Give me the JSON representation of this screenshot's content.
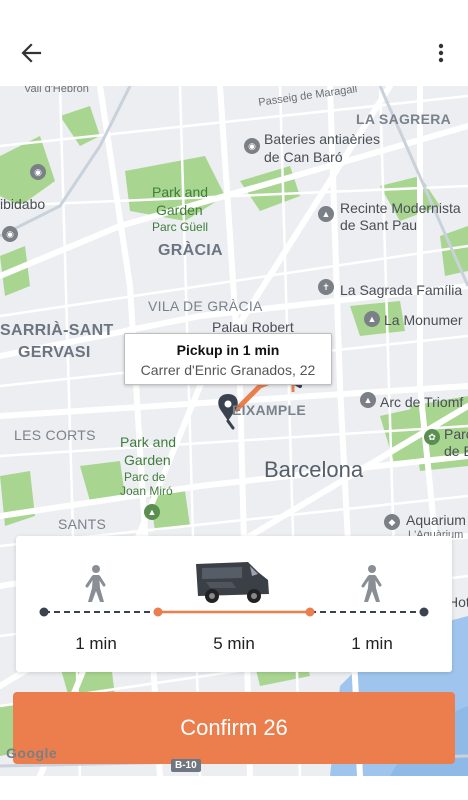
{
  "header": {
    "back_icon": "arrow-left-icon",
    "more_icon": "more-vertical-icon"
  },
  "map": {
    "labels": {
      "vall_hebron": "Vall d'Hebron",
      "passeig_maragall": "Passeig de Maragall",
      "la_sagrera": "LA SAGRERA",
      "bateries_1": "Bateries antiaèries",
      "bateries_2": "de Can Baró",
      "tibidabo": "ibidabo",
      "park_guell_1": "Park and",
      "park_guell_2": "Garden",
      "park_guell_3": "Parc Güell",
      "recinte_1": "Recinte Modernista",
      "recinte_2": "de Sant Pau",
      "gracia": "GRÀCIA",
      "sagrada": "La Sagrada Família",
      "vila_gracia": "VILA DE GRÀCIA",
      "palau_robert": "Palau Robert",
      "monument": "La Monumer",
      "sarria_1": "SARRIÀ-SANT",
      "sarria_2": "GERVASI",
      "eixample": "EIXAMPLE",
      "arc_triomf": "Arc de Triomf",
      "les_corts": "LES CORTS",
      "park_miro_1": "Park and",
      "park_miro_2": "Garden",
      "park_miro_3": "Parc de",
      "park_miro_4": "Joan Miró",
      "barcelona": "Barcelona",
      "parc_right_1": "Parc",
      "parc_right_2": "de B",
      "sants": "SANTS",
      "aquarium_1": "Aquarium",
      "aquarium_2": "L'Aquàrium",
      "hotel": "Hot",
      "road_shield": "B-10",
      "google": "Google"
    },
    "pickup_tooltip": {
      "title": "Pickup in 1 min",
      "address": "Carrer d'Enric Granados, 22"
    }
  },
  "route_card": {
    "segments": [
      {
        "mode": "walking-person-icon",
        "time": "1 min"
      },
      {
        "mode": "van-icon",
        "time": "5 min"
      },
      {
        "mode": "walking-person-icon",
        "time": "1 min"
      }
    ],
    "colors": {
      "walk": "#3a4250",
      "ride": "#ec7e4d"
    }
  },
  "confirm": {
    "label": "Confirm 26"
  },
  "colors": {
    "accent": "#ec7e4d",
    "map_bg": "#eceef1",
    "park": "#a8d690"
  }
}
